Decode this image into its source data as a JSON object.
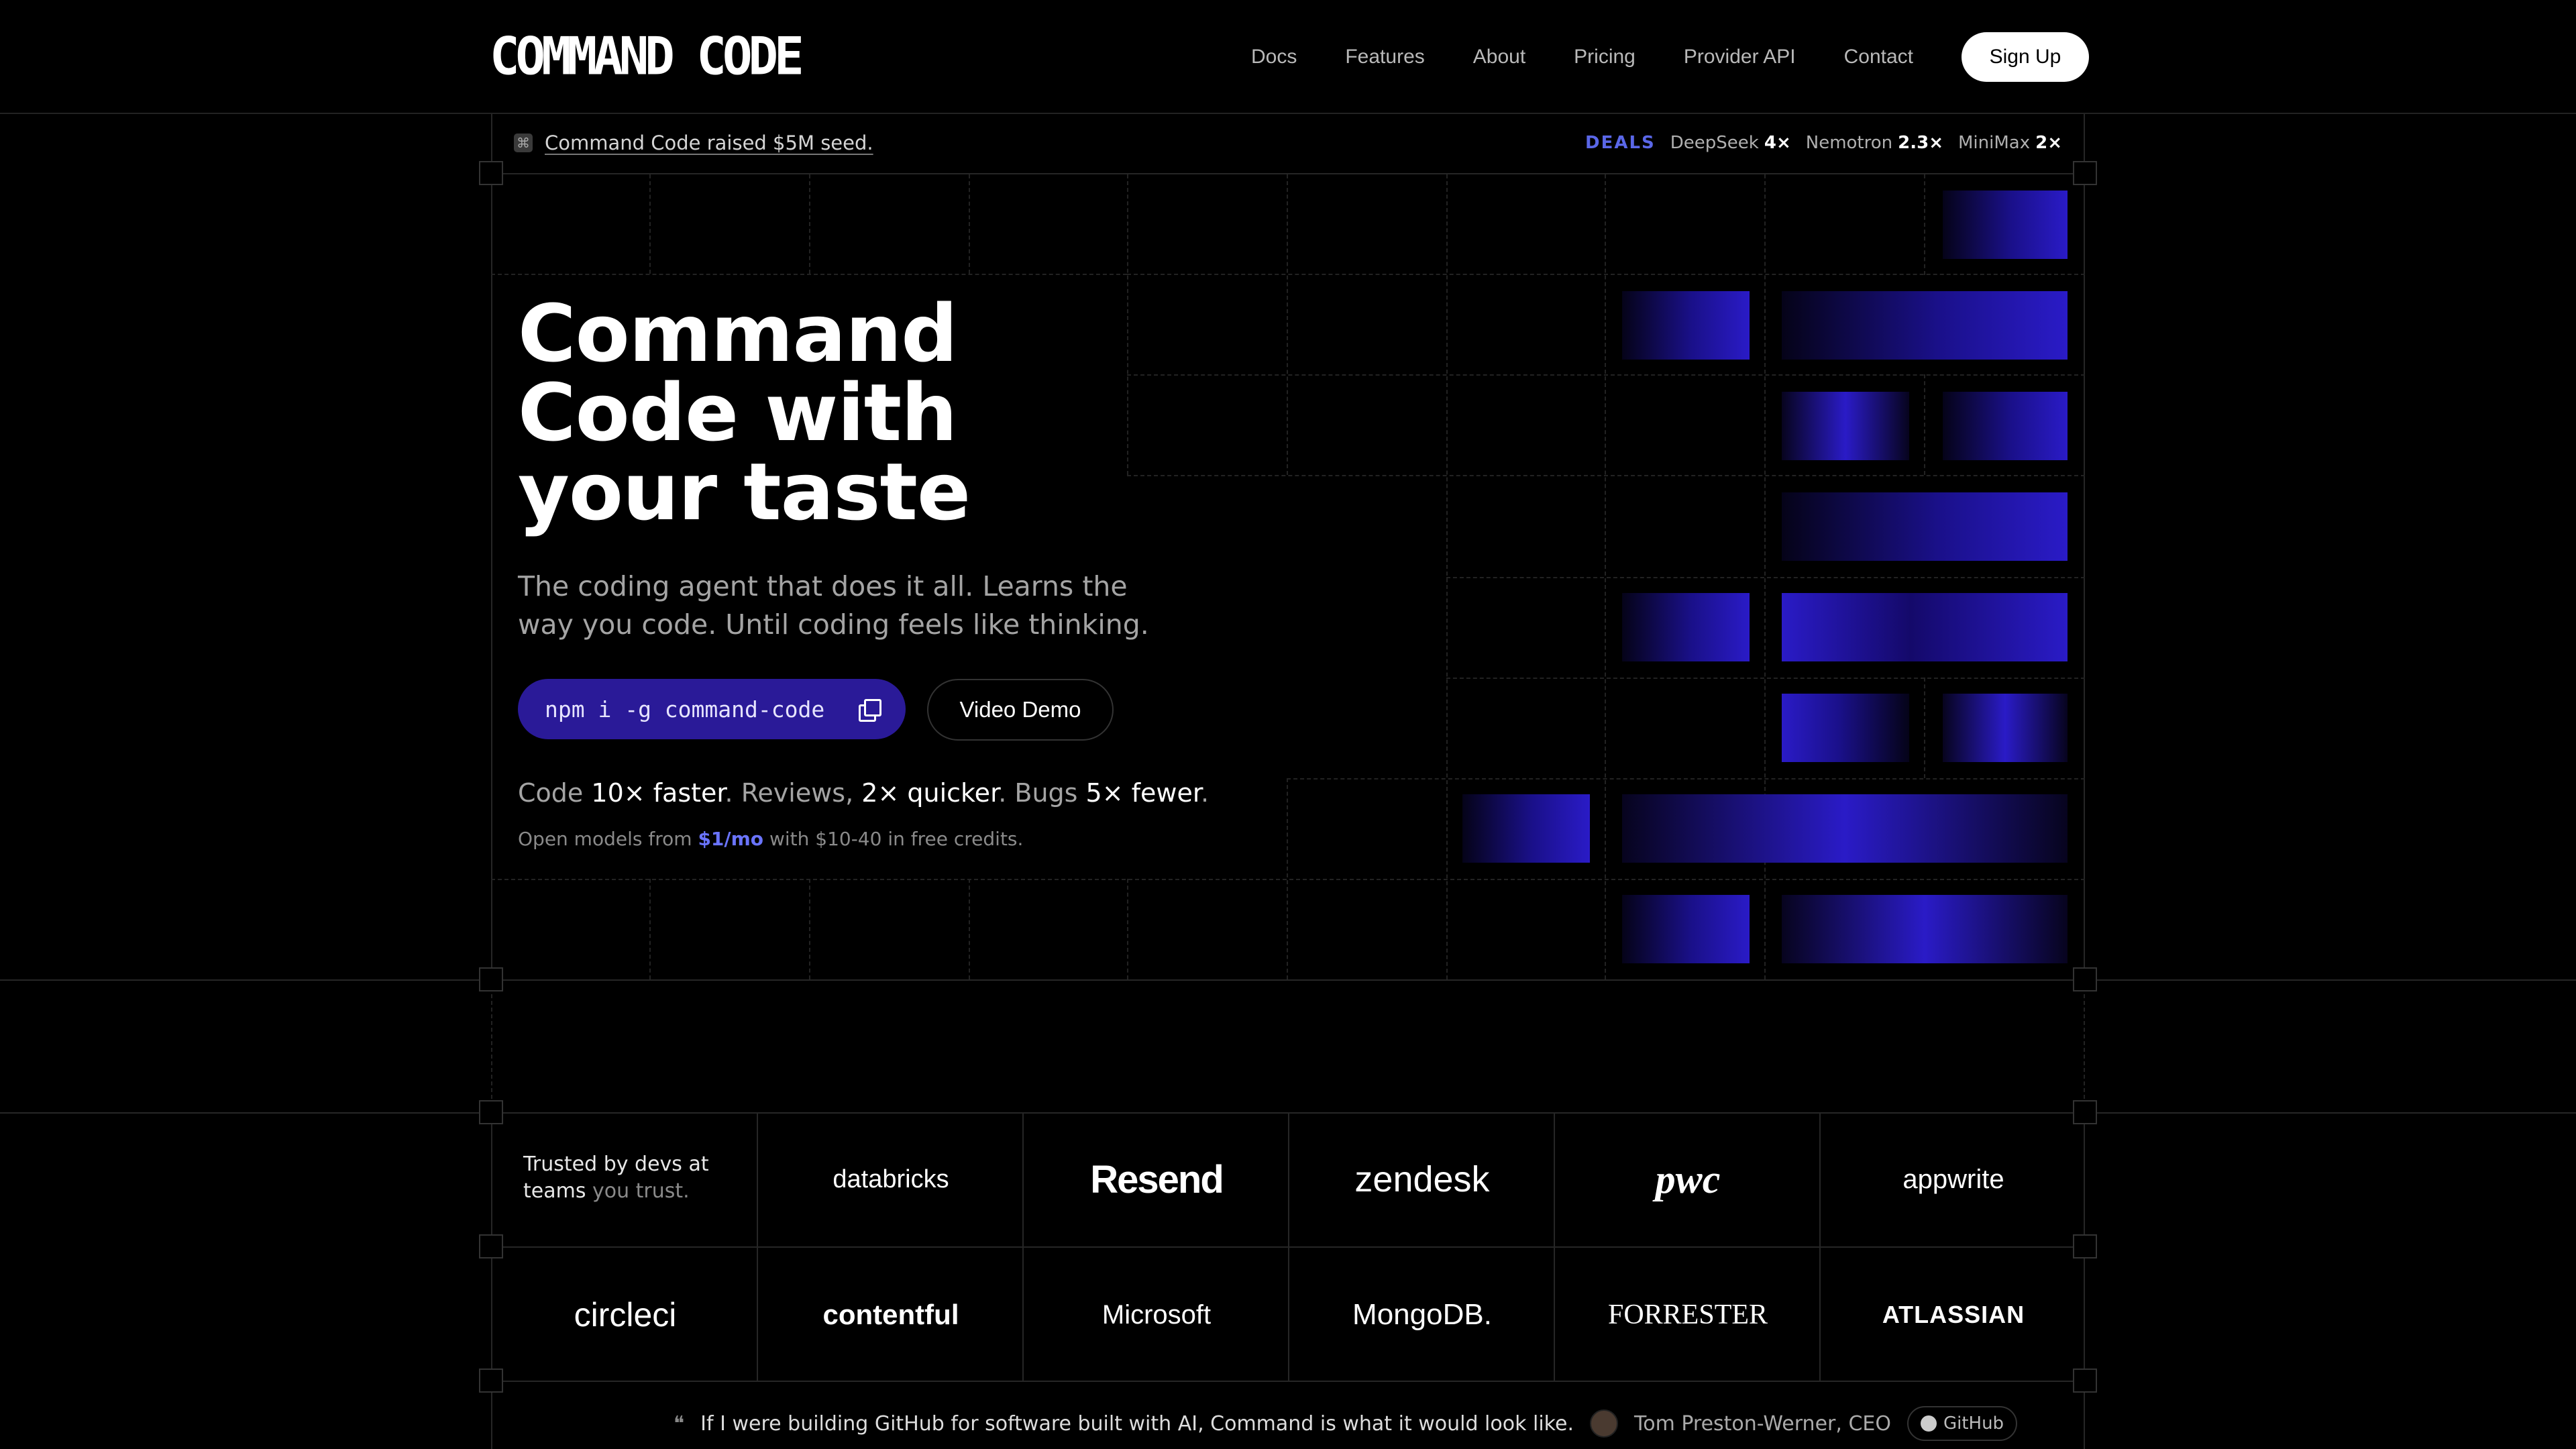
{
  "header": {
    "logo": "COMMAND CODE",
    "nav": [
      "Docs",
      "Features",
      "About",
      "Pricing",
      "Provider API",
      "Contact"
    ],
    "signup_label": "Sign Up"
  },
  "announcement": {
    "icon": "badge-icon",
    "text": "Command Code raised $5M seed."
  },
  "deals": {
    "label": "DEALS",
    "items": [
      {
        "name": "DeepSeek",
        "value": "4×"
      },
      {
        "name": "Nemotron",
        "value": "2.3×"
      },
      {
        "name": "MiniMax",
        "value": "2×"
      }
    ]
  },
  "hero": {
    "title_line1": "Command",
    "title_line2": "Code with",
    "title_line3": "your taste",
    "subtitle": "The coding agent that does it all. Learns the way you code. Until coding feels like thinking.",
    "install_command": "npm i -g command-code",
    "demo_label": "Video Demo",
    "stats": {
      "s1": "Code",
      "s1b": "10× faster",
      "s2": "Reviews,",
      "s2b": "2× quicker",
      "s3": "Bugs",
      "s3b": "5× fewer"
    },
    "credits_pre": "Open models from",
    "credits_price": "$1/mo",
    "credits_post": "with $10-40 in free credits."
  },
  "trusted": {
    "line1": "Trusted by devs at",
    "line2a": "teams",
    "line2b": "you trust.",
    "brands": [
      "databricks",
      "Resend",
      "zendesk",
      "pwc",
      "appwrite",
      "circleci",
      "contentful",
      "Microsoft",
      "MongoDB.",
      "FORRESTER",
      "ATLASSIAN"
    ]
  },
  "quote": {
    "text": "If I were building GitHub for software built with AI, Command is what it would look like.",
    "author": "Tom Preston-Werner, CEO",
    "badge": "GitHub"
  },
  "colors": {
    "accent": "#2a1a98",
    "bar": "#2a1bc7",
    "link": "#6a74ff",
    "background": "#000000"
  }
}
